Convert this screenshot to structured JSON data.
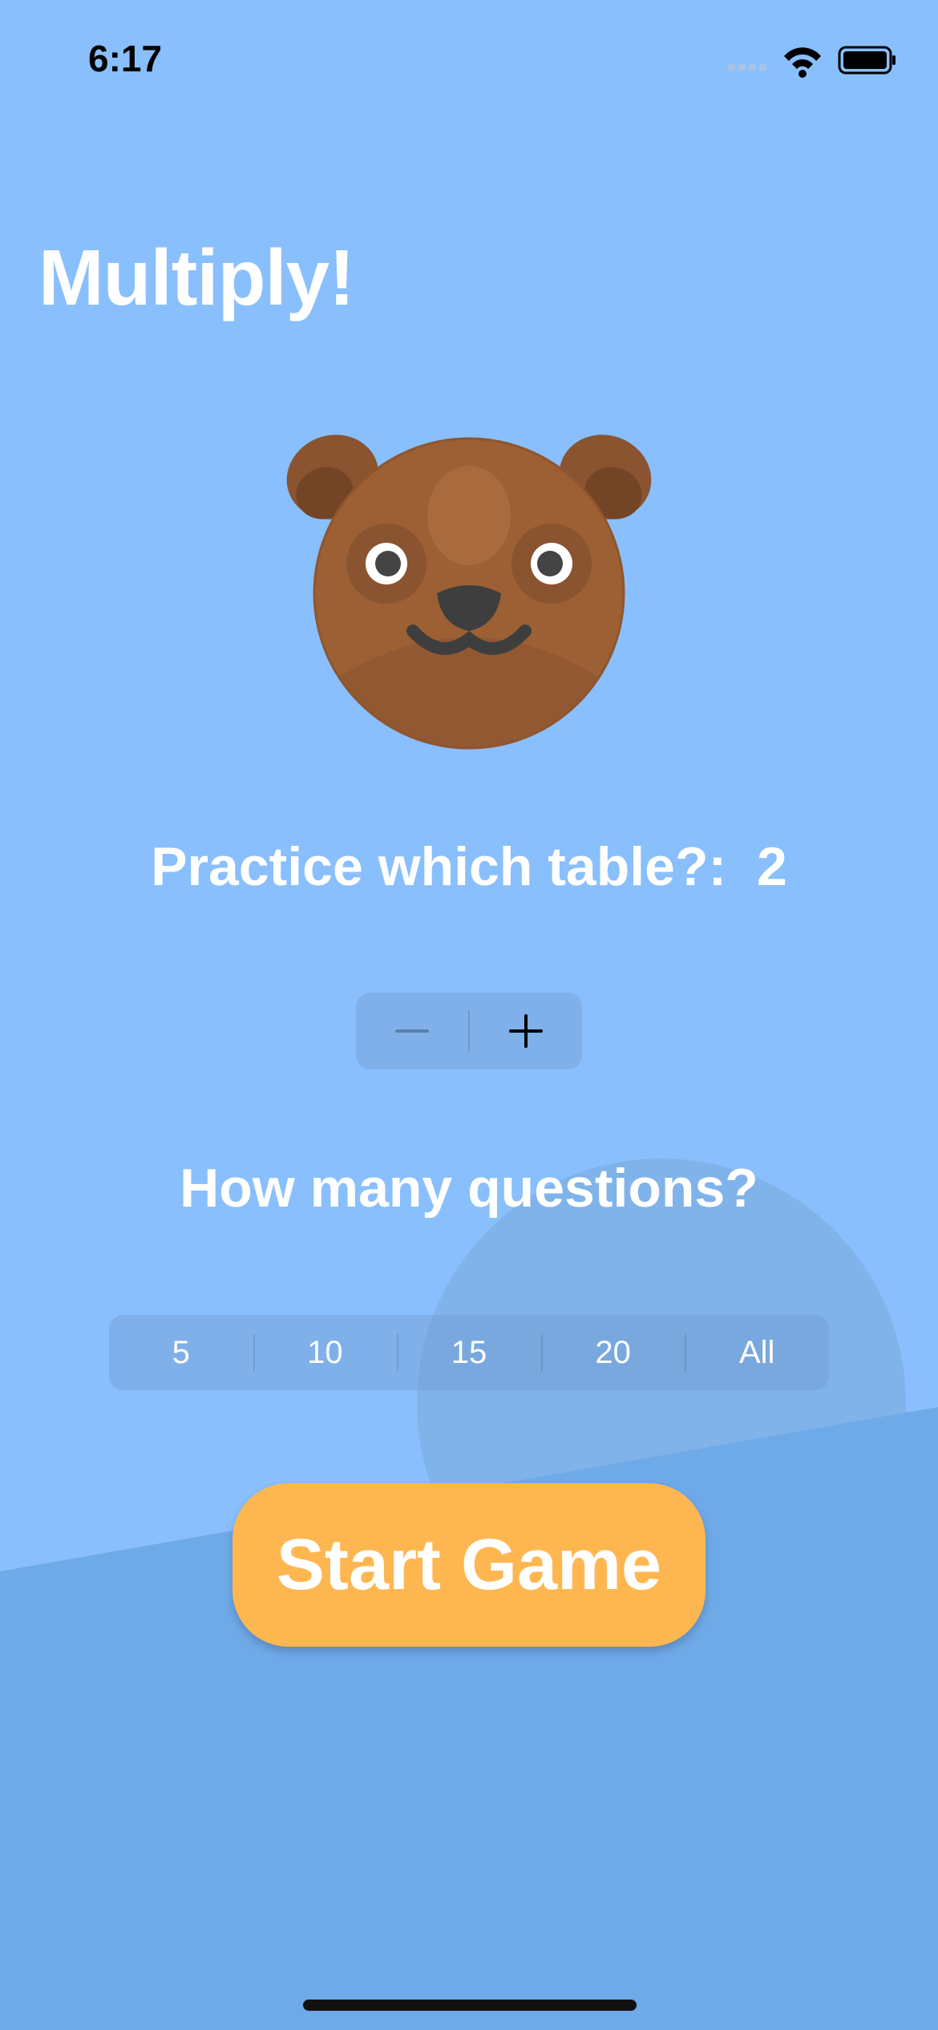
{
  "status_bar": {
    "time": "6:17"
  },
  "header": {
    "title": "Multiply!"
  },
  "table_picker": {
    "prompt": "Practice which table?:",
    "value": "2",
    "decrement_symbol": "−",
    "increment_symbol": "+"
  },
  "question_count": {
    "prompt": "How many questions?",
    "options": [
      "5",
      "10",
      "15",
      "20",
      "All"
    ]
  },
  "start_button": {
    "label": "Start Game"
  },
  "colors": {
    "background": "#89BFFC",
    "background_shape": "#6EA9E8",
    "start_button": "#FEB750",
    "text": "#FFFFFF"
  },
  "icons": {
    "avatar": "bear-face-icon",
    "wifi": "wifi-icon",
    "battery": "battery-icon",
    "signal": "cellular-signal-icon"
  }
}
